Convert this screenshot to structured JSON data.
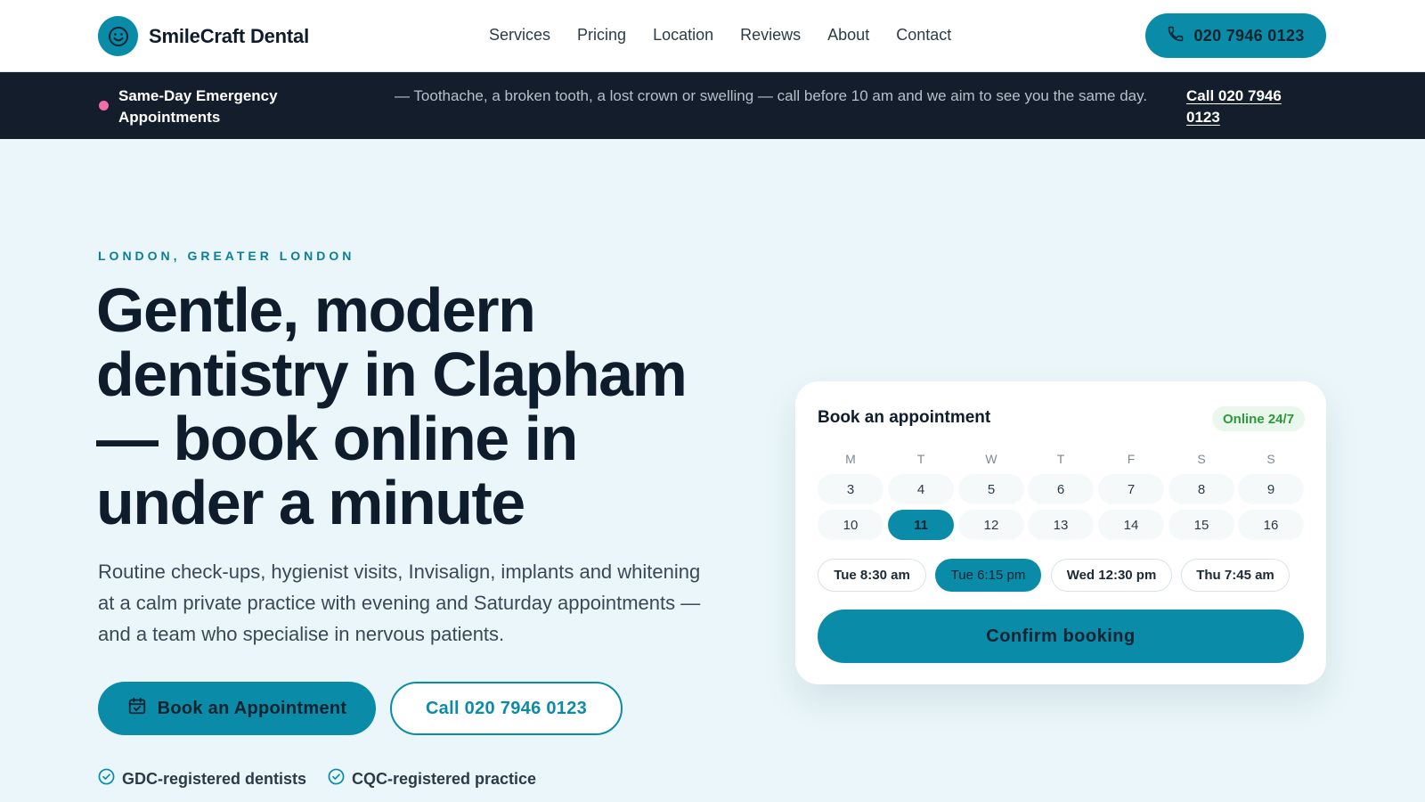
{
  "brand": {
    "name": "SmileCraft Dental",
    "logo_icon": "smile-icon",
    "accent": "#0a8ca8"
  },
  "nav": {
    "items": [
      "Services",
      "Pricing",
      "Location",
      "Reviews",
      "About",
      "Contact"
    ]
  },
  "header": {
    "phone_label": "020 7946 0123",
    "phone_icon": "phone-icon"
  },
  "banner": {
    "title": "Same-Day Emergency Appointments",
    "text": "— Toothache, a broken tooth, a lost crown or swelling — call before 10 am and we aim to see you the same day.",
    "call_link": "Call 020 7946 0123",
    "dot_color": "#f06ea5"
  },
  "hero": {
    "eyebrow": "LONDON, GREATER LONDON",
    "headline": "Gentle, modern dentistry in Clapham — book online in under a minute",
    "lead": "Routine check-ups, hygienist visits, Invisalign, implants and whitening at a calm private practice with evening and Saturday appointments — and a team who specialise in nervous patients.",
    "book_button": "Book an Appointment",
    "book_icon": "calendar-check-icon",
    "call_button": "Call 020 7946 0123",
    "trust": [
      "GDC-registered dentists",
      "CQC-registered practice"
    ],
    "trust_icon": "check-circle-icon"
  },
  "booking": {
    "title": "Book an appointment",
    "badge": "Online 24/7",
    "weekdays": [
      "M",
      "T",
      "W",
      "T",
      "F",
      "S",
      "S"
    ],
    "weeks": [
      [
        "3",
        "4",
        "5",
        "6",
        "7",
        "8",
        "9"
      ],
      [
        "10",
        "11",
        "12",
        "13",
        "14",
        "15",
        "16"
      ]
    ],
    "selected_day": "11",
    "slots": [
      "Tue 8:30 am",
      "Tue 6:15 pm",
      "Wed 12:30 pm",
      "Thu 7:45 am"
    ],
    "selected_slot": "Tue 6:15 pm",
    "confirm": "Confirm booking"
  }
}
